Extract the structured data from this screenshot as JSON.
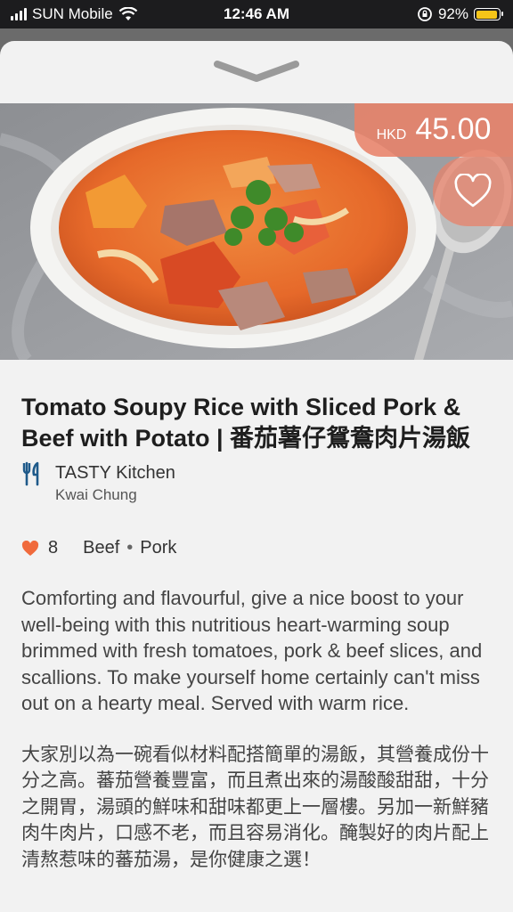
{
  "status_bar": {
    "carrier": "SUN Mobile",
    "time": "12:46 AM",
    "battery_percent": "92%",
    "battery_level": 0.92,
    "battery_color": "#f5c518"
  },
  "item": {
    "currency": "HKD",
    "price": "45.00",
    "title": "Tomato Soupy Rice with Sliced Pork & Beef with Potato | 番茄薯仔鴛鴦肉片湯飯",
    "restaurant_name": "TASTY Kitchen",
    "restaurant_area": "Kwai Chung",
    "likes": "8",
    "tags": [
      "Beef",
      "Pork"
    ],
    "description": "Comforting and flavourful, give a nice boost to your well-being with this nutritious heart-warming soup brimmed with fresh tomatoes, pork & beef slices, and scallions. To make yourself home certainly can't miss out on a hearty meal. Served with warm rice.",
    "description_zh": "大家別以為一碗看似材料配搭簡單的湯飯，其營養成份十分之高。蕃茄營養豐富，而且煮出來的湯酸酸甜甜，十分之開胃，湯頭的鮮味和甜味都更上一層樓。另加一新鮮豬肉牛肉片，口感不老，而且容易消化。醃製好的肉片配上清熬惹味的蕃茄湯，是你健康之選！"
  },
  "colors": {
    "accent": "#e88269",
    "heart": "#f06a3c",
    "restaurant_icon": "#1f5a8a"
  },
  "icons": {
    "collapse": "chevron-down-icon",
    "favorite": "heart-outline-icon",
    "restaurant": "fork-knife-icon",
    "likes": "heart-filled-icon"
  }
}
